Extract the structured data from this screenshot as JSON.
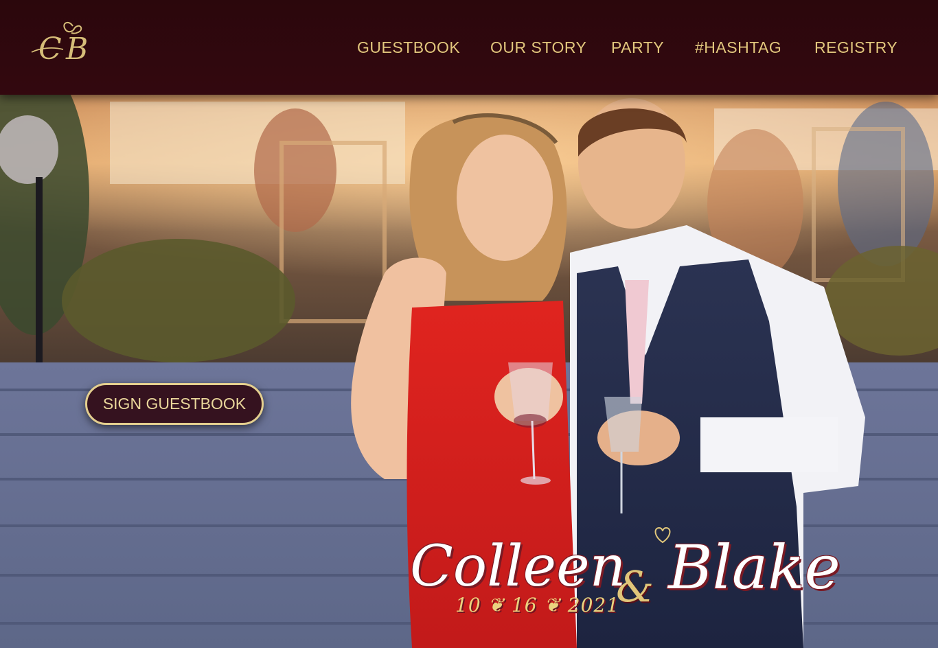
{
  "header": {
    "logo_letters": "CB",
    "nav": [
      {
        "label": "GUESTBOOK"
      },
      {
        "label": "OUR STORY"
      },
      {
        "label": "PARTY"
      },
      {
        "label": "#HASHTAG"
      },
      {
        "label": "REGISTRY"
      }
    ]
  },
  "hero": {
    "cta_label": "SIGN GUESTBOOK",
    "name_left": "Colleen",
    "ampersand": "&",
    "name_right": "Blake",
    "date": "10 ❦ 16 ❦ 2021"
  },
  "colors": {
    "header_bg": "#2b070c",
    "gold": "#e2c77d",
    "cta_bg": "#35121f",
    "name_shadow": "#7a1a24"
  }
}
